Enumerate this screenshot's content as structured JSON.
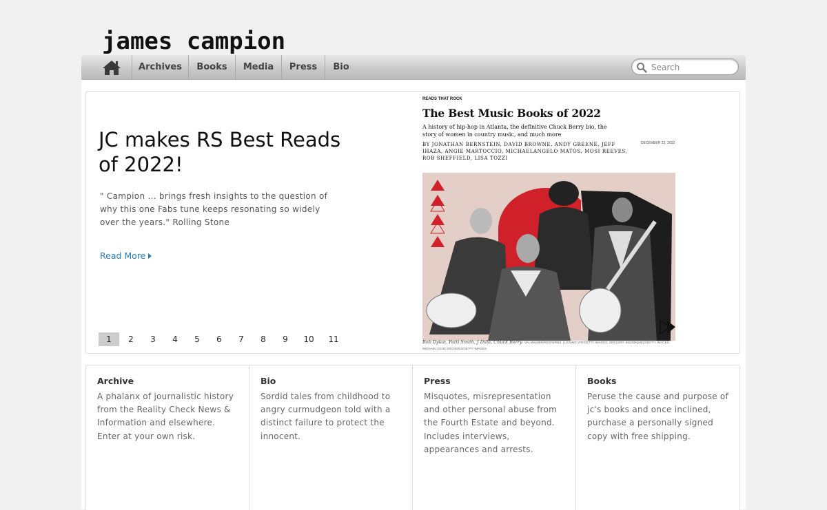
{
  "site": {
    "logo_text": "james campion"
  },
  "nav": {
    "home_icon": "home-icon",
    "items": [
      "Archives",
      "Books",
      "Media",
      "Press",
      "Bio"
    ],
    "search_placeholder": "Search"
  },
  "feature": {
    "headline": "JC makes RS Best Reads of 2022!",
    "quote": "\" Campion ... brings fresh insights to the question of why this one Fabs tune keeps resonating so widely over the years.\"  Rolling Stone",
    "read_more": "Read More",
    "pages": [
      "1",
      "2",
      "3",
      "4",
      "5",
      "6",
      "7",
      "8",
      "9",
      "10",
      "11"
    ],
    "active_page": "1",
    "article": {
      "kicker": "READS THAT ROCK",
      "title": "The Best Music Books of 2022",
      "subtitle": "A history of hip-hop in Atlanta, the definitive Chuck Berry bio, the story of women in country music, and much more",
      "byline": "BY JONATHAN BERNSTEIN, DAVID BROWNE, ANDY GREENE, JEFF IHAZA, ANGIE MARTOCCIO, MICHAELANGELO MATOS, MOSI REEVES, ROB SHEFFIELD, LISA TOZZI",
      "date": "DECEMBER 23, 2022",
      "caption": "Bob Dylan, Patti Smith, J Dilla, Chuck Berry.",
      "credit": "VAL WILMER/REDFERNS; LUCIANO VITI/GETTY IMAGES; GREGORY BOJORQUEZ/GETTY IMAGES; MICHAEL OCHS ARCHIVES/GETTY IMAGES"
    }
  },
  "cards": [
    {
      "title": "Archive",
      "text": "A phalanx of journalistic history from the Reality Check News & Information and elsewhere. Enter at your own risk."
    },
    {
      "title": "Bio",
      "text": "Sordid tales from childhood to angry curmudgeon told with a distinct failure to protect the innocent."
    },
    {
      "title": "Press",
      "text": "Misquotes, misrepresentation and other personal abuse from the Fourth Estate and beyond. Includes interviews, appearances and arrests."
    },
    {
      "title": "Books",
      "text": "Peruse the cause and purpose of jc's books and once inclined, purchase a personally signed copy with free shipping."
    }
  ],
  "colors": {
    "link": "#2a7bb8",
    "accent_red": "#d0202a",
    "nav_gray": "#c9c9c9"
  }
}
